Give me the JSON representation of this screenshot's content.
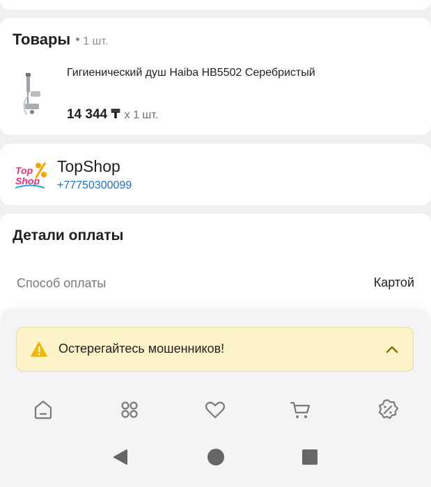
{
  "goods": {
    "title": "Товары",
    "count": "1 шт.",
    "product": {
      "name": "Гигиенический душ Haiba HB5502 Серебристый",
      "price": "14 344 ₸",
      "quantity": "x 1 шт.",
      "thumbnail_icon": "hygienic-shower-image"
    }
  },
  "shop": {
    "logo_text_line1": "Top",
    "logo_text_line2": "Shop",
    "name": "TopShop",
    "phone": "+77750300099"
  },
  "payment": {
    "title": "Детали оплаты",
    "method_label": "Способ оплаты",
    "method_value": "Картой"
  },
  "warning": {
    "text": "Остерегайтесь мошенников!",
    "icon": "warning-triangle-icon",
    "toggle_icon": "chevron-up-icon"
  },
  "bottom_nav": [
    {
      "name": "home",
      "icon": "home-icon"
    },
    {
      "name": "catalog",
      "icon": "grid-icon"
    },
    {
      "name": "favorites",
      "icon": "heart-icon"
    },
    {
      "name": "cart",
      "icon": "cart-icon"
    },
    {
      "name": "promotions",
      "icon": "discount-badge-icon"
    }
  ],
  "system_nav": [
    "back",
    "home",
    "recents"
  ],
  "colors": {
    "accent_blue": "#1f73c3",
    "warning_bg": "#fdf3c8",
    "warning_icon": "#f2b705",
    "chevron": "#8a6a00",
    "nav_icon": "#7a7a7a"
  }
}
